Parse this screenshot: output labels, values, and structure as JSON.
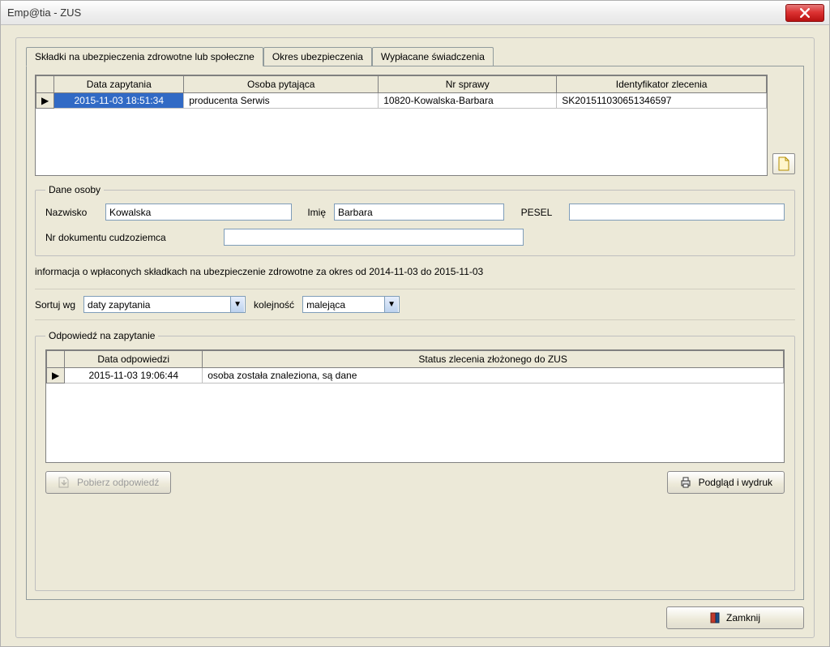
{
  "window": {
    "title": "Emp@tia - ZUS"
  },
  "tabs": [
    {
      "label": "Składki na ubezpieczenia zdrowotne lub społeczne",
      "active": true
    },
    {
      "label": "Okres ubezpieczenia",
      "active": false
    },
    {
      "label": "Wypłacane świadczenia",
      "active": false
    }
  ],
  "query_table": {
    "headers": [
      "",
      "Data zapytania",
      "Osoba pytająca",
      "Nr sprawy",
      "Identyfikator zlecenia"
    ],
    "rows": [
      {
        "marker": "▶",
        "date": "2015-11-03 18:51:34",
        "person": "producenta Serwis",
        "case_no": "10820-Kowalska-Barbara",
        "order_id": "SK201511030651346597"
      }
    ]
  },
  "person": {
    "legend": "Dane osoby",
    "surname_label": "Nazwisko",
    "surname": "Kowalska",
    "name_label": "Imię",
    "name": "Barbara",
    "pesel_label": "PESEL",
    "pesel": "",
    "docnr_label": "Nr dokumentu cudzoziemca",
    "docnr": ""
  },
  "info_line": "informacja o wpłaconych składkach na ubezpieczenie zdrowotne za okres od 2014-11-03 do 2015-11-03",
  "sort": {
    "label": "Sortuj wg",
    "by": "daty zapytania",
    "order_label": "kolejność",
    "order": "malejąca"
  },
  "response": {
    "legend": "Odpowiedź na zapytanie",
    "headers": [
      "",
      "Data odpowiedzi",
      "Status zlecenia złożonego do ZUS"
    ],
    "rows": [
      {
        "marker": "▶",
        "date": "2015-11-03 19:06:44",
        "status": "osoba została znaleziona, są dane"
      }
    ]
  },
  "buttons": {
    "download": "Pobierz odpowiedź",
    "preview": "Podgląd i wydruk",
    "close": "Zamknij"
  }
}
